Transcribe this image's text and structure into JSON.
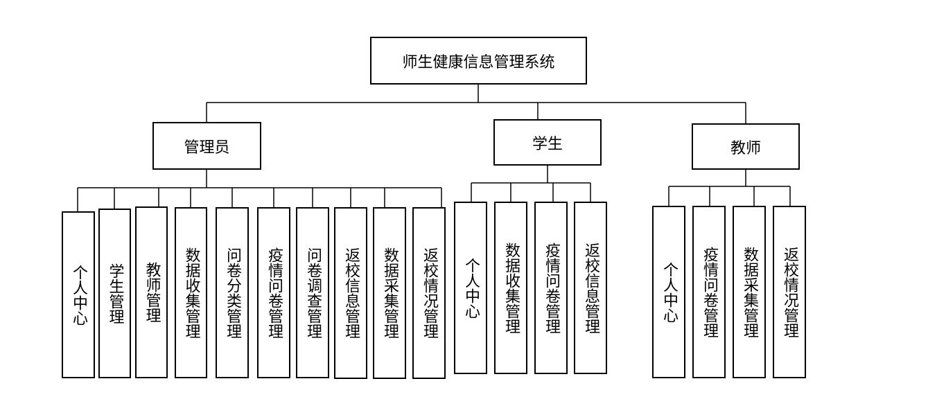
{
  "root": {
    "label": "师生健康信息管理系统"
  },
  "roles": [
    {
      "label": "管理员",
      "modules": [
        "个人中心",
        "学生管理",
        "教师管理",
        "数据收集管理",
        "问卷分类管理",
        "疫情问卷管理",
        "问卷调查管理",
        "返校信息管理",
        "数据采集管理",
        "返校情况管理"
      ]
    },
    {
      "label": "学生",
      "modules": [
        "个人中心",
        "数据收集管理",
        "疫情问卷管理",
        "返校信息管理"
      ]
    },
    {
      "label": "教师",
      "modules": [
        "个人中心",
        "疫情问卷管理",
        "数据采集管理",
        "返校情况管理"
      ]
    }
  ]
}
